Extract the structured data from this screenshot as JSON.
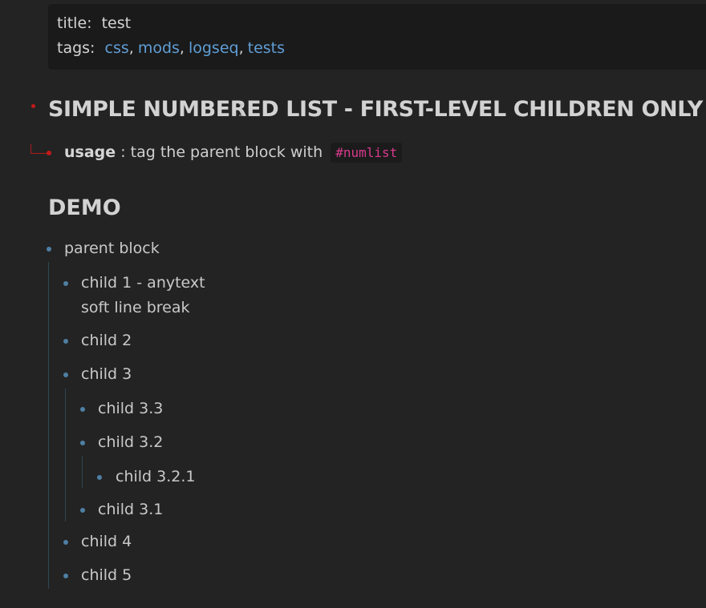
{
  "properties": {
    "title_key": "title:",
    "title_value": "test",
    "tags_key": "tags:",
    "tags": [
      "css",
      "mods",
      "logseq",
      "tests"
    ]
  },
  "heading": "SIMPLE NUMBERED LIST - FIRST-LEVEL CHILDREN ONLY",
  "usage": {
    "label": "usage",
    "text": " : tag the parent block with",
    "code": "#numlist"
  },
  "demo_heading": "DEMO",
  "blocks": {
    "parent": "parent block",
    "child1_line1": "child 1 - anytext",
    "child1_line2": "soft line break",
    "child2": "child 2",
    "child3": "child 3",
    "child3_3": "child 3.3",
    "child3_2": "child 3.2",
    "child3_2_1": "child 3.2.1",
    "child3_1": "child 3.1",
    "child4": "child 4",
    "child5": "child 5"
  },
  "colors": {
    "background": "#232323",
    "properties_bg": "#1a1a1a",
    "tag_link": "#5f9ed6",
    "heading_bullet": "#c21a1a",
    "bullet": "#4f7fa3",
    "code": "#d63a8c"
  },
  "icons": {
    "cursor": "text-cursor-icon"
  }
}
